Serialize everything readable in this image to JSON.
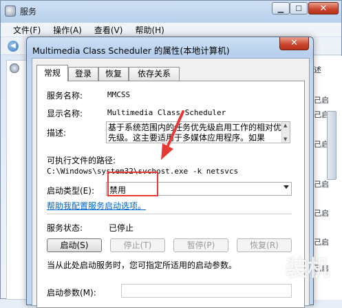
{
  "bg_window": {
    "title": "服务",
    "menu": [
      "文件(F)",
      "操作(A)",
      "查看(V)",
      "帮助(H)"
    ],
    "right_pane_fragments": [
      "述",
      "己启",
      "己启",
      "己启",
      "己启",
      "己启",
      "己启",
      "己启"
    ]
  },
  "dialog": {
    "title": "Multimedia Class Scheduler 的属性(本地计算机)",
    "close_label": "✕",
    "tabs": [
      "常规",
      "登录",
      "恢复",
      "依存关系"
    ],
    "general": {
      "service_name_label": "服务名称:",
      "service_name_value": "MMCSS",
      "display_name_label": "显示名称:",
      "display_name_value": "Multimedia Class Scheduler",
      "description_label": "描述:",
      "description_value": "基于系统范围内的任务优先级启用工作的相对优先级。这主要适用于多媒体应用程序。如果",
      "exe_path_label": "可执行文件的路径:",
      "exe_path_value": "C:\\Windows\\system32\\svchost.exe -k netsvcs",
      "startup_type_label": "启动类型(E):",
      "startup_type_value": "禁用",
      "help_link": "帮助我配置服务启动选项。",
      "status_label": "服务状态:",
      "status_value": "已停止",
      "buttons": {
        "start": "启动(S)",
        "stop": "停止(T)",
        "pause": "暂停(P)",
        "resume": "恢复(R)"
      },
      "hint_text": "当从此处启动服务时，您可指定所适用的启动参数。",
      "start_params_label": "启动参数(M):",
      "start_params_value": ""
    }
  },
  "watermark": "装机"
}
